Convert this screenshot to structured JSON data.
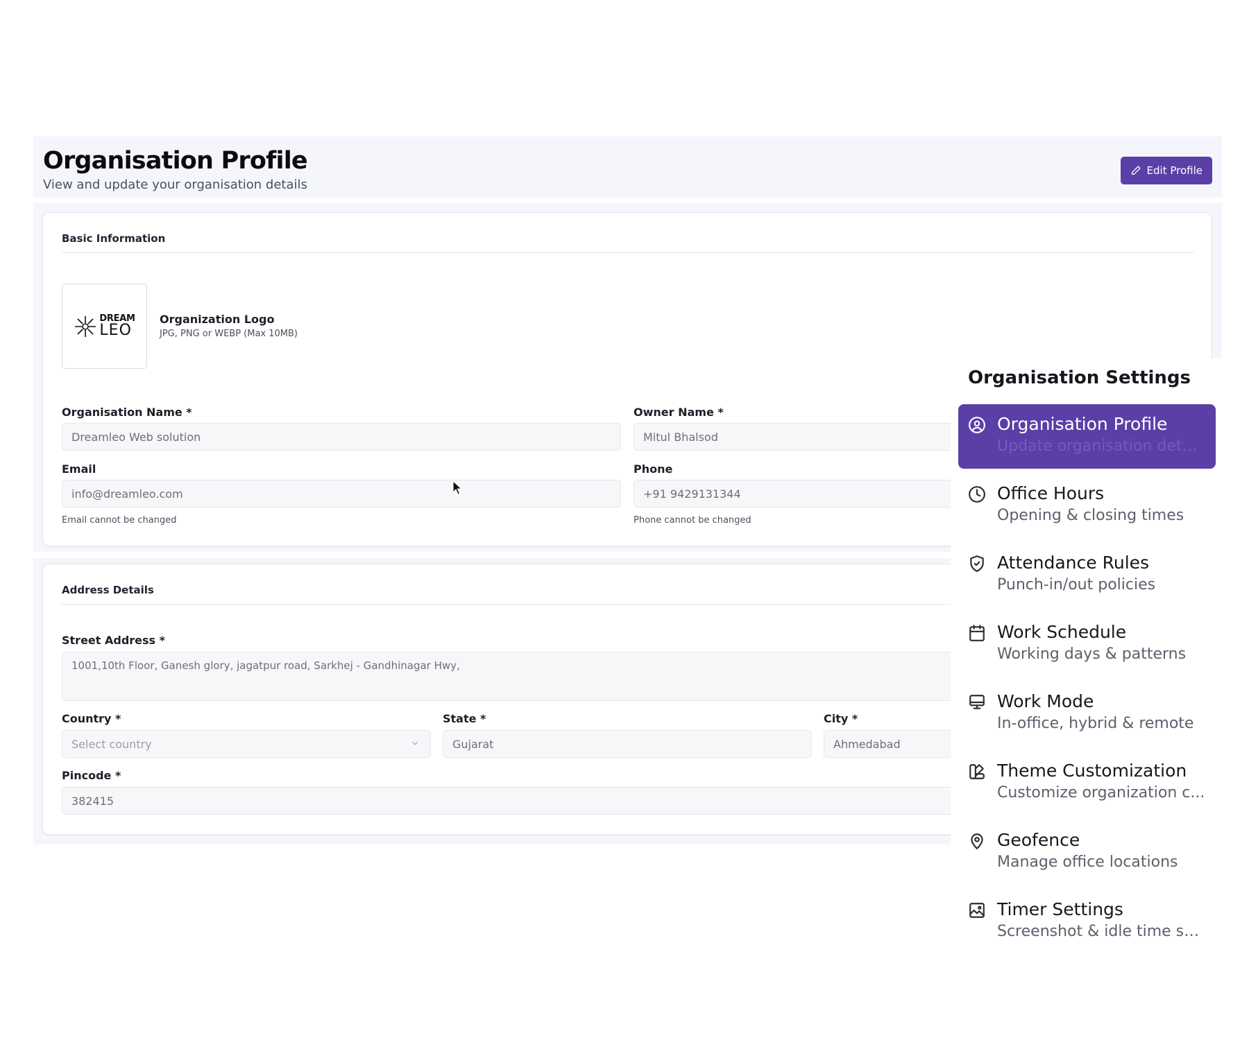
{
  "header": {
    "title": "Organisation Profile",
    "subtitle": "View and update your organisation details",
    "edit_button": "Edit Profile"
  },
  "basic_info": {
    "section_title": "Basic Information",
    "logo_top": "DREAM",
    "logo_bottom": "LEO",
    "logo_label": "Organization Logo",
    "logo_hint": "JPG, PNG or WEBP (Max 10MB)",
    "org_name_label": "Organisation Name *",
    "org_name_value": "Dreamleo Web solution",
    "owner_name_label": "Owner Name *",
    "owner_name_value": "Mitul Bhalsod",
    "email_label": "Email",
    "email_value": "info@dreamleo.com",
    "email_helper": "Email cannot be changed",
    "phone_label": "Phone",
    "phone_value": "+91 9429131344",
    "phone_helper": "Phone cannot be changed"
  },
  "address": {
    "section_title": "Address Details",
    "street_label": "Street Address *",
    "street_value": "1001,10th Floor, Ganesh glory, jagatpur road, Sarkhej - Gandhinagar Hwy,",
    "country_label": "Country *",
    "country_placeholder": "Select country",
    "state_label": "State *",
    "state_value": "Gujarat",
    "city_label": "City *",
    "city_value": "Ahmedabad",
    "pincode_label": "Pincode *",
    "pincode_value": "382415"
  },
  "settings": {
    "title": "Organisation Settings",
    "items": [
      {
        "label": "Organisation Profile",
        "sub": "Update organisation details",
        "icon": "user-circle-icon",
        "active": true
      },
      {
        "label": "Office Hours",
        "sub": "Opening & closing times",
        "icon": "clock-icon",
        "active": false
      },
      {
        "label": "Attendance Rules",
        "sub": "Punch-in/out policies",
        "icon": "shield-check-icon",
        "active": false
      },
      {
        "label": "Work Schedule",
        "sub": "Working days & patterns",
        "icon": "calendar-icon",
        "active": false
      },
      {
        "label": "Work Mode",
        "sub": "In-office, hybrid & remote",
        "icon": "monitor-icon",
        "active": false
      },
      {
        "label": "Theme Customization",
        "sub": "Customize organization c...",
        "icon": "palette-icon",
        "active": false
      },
      {
        "label": "Geofence",
        "sub": "Manage office locations",
        "icon": "map-pin-icon",
        "active": false
      },
      {
        "label": "Timer Settings",
        "sub": "Screenshot & idle time set...",
        "icon": "image-icon",
        "active": false
      }
    ]
  },
  "colors": {
    "accent": "#5b3fa6",
    "band_background": "#f5f6fb"
  }
}
